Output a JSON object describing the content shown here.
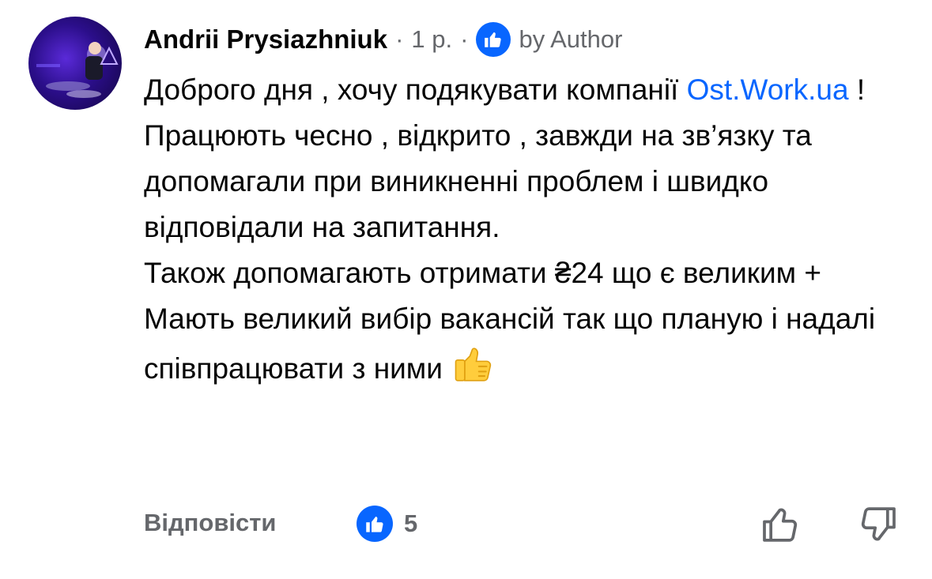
{
  "comment": {
    "author": "Andrii Prysiazhniuk",
    "time": "1 р.",
    "separator": "·",
    "badge_label": "by Author",
    "paragraphs": [
      {
        "text_before": "Доброго дня , хочу подякувати компанії ",
        "link": "Ost.Work.ua",
        "text_after": " !"
      },
      {
        "text": "Працюють чесно , відкрито , завжди на зв’язку та допомагали при виникненні проблем і швидко відповідали на запитання."
      },
      {
        "text": "Також допомагають отримати ₴24 що є великим +"
      },
      {
        "text_before": "Мають великий вибір вакансій так що планую і надалі співпрацювати з ними ",
        "emoji": "thumbs-up-emoji"
      }
    ]
  },
  "actions": {
    "reply_label": "Відповісти",
    "like_count": "5",
    "like_icon": "like-icon",
    "upvote_icon": "thumb-up-outline-icon",
    "downvote_icon": "thumb-down-outline-icon"
  },
  "colors": {
    "accent": "#0866ff",
    "secondary_text": "#65676b",
    "primary_text": "#050505"
  }
}
